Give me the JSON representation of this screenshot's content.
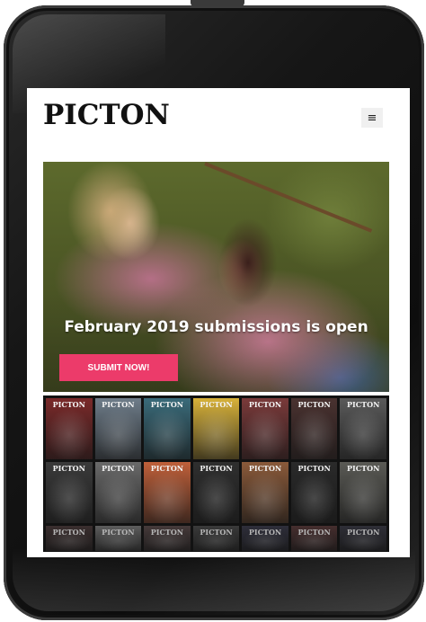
{
  "site": {
    "logo": "PICTON",
    "menu_icon": "hamburger-icon",
    "menu_glyph": "≡"
  },
  "hero": {
    "title": "February 2019 submissions is open",
    "cta_label": "SUBMIT NOW!"
  },
  "covers": {
    "title": "PICTON",
    "items": [
      "#7a2a2a",
      "#6f7d8a",
      "#3a6b7a",
      "#d8b23a",
      "#7a3a3a",
      "#4a3230",
      "#5a5a5a",
      "#3a3a3a",
      "#6a6a6a",
      "#c0603a",
      "#2f2f2f",
      "#8a5a3a",
      "#2a2a2a",
      "#5a5a55",
      "#4a3a3a",
      "#7a7a7a",
      "#5a4a4a",
      "#4a4a4a",
      "#3a3a4a",
      "#5a3a3a",
      "#3a3a45"
    ]
  },
  "colors": {
    "accent": "#ec3b6a",
    "device": "#161616"
  }
}
